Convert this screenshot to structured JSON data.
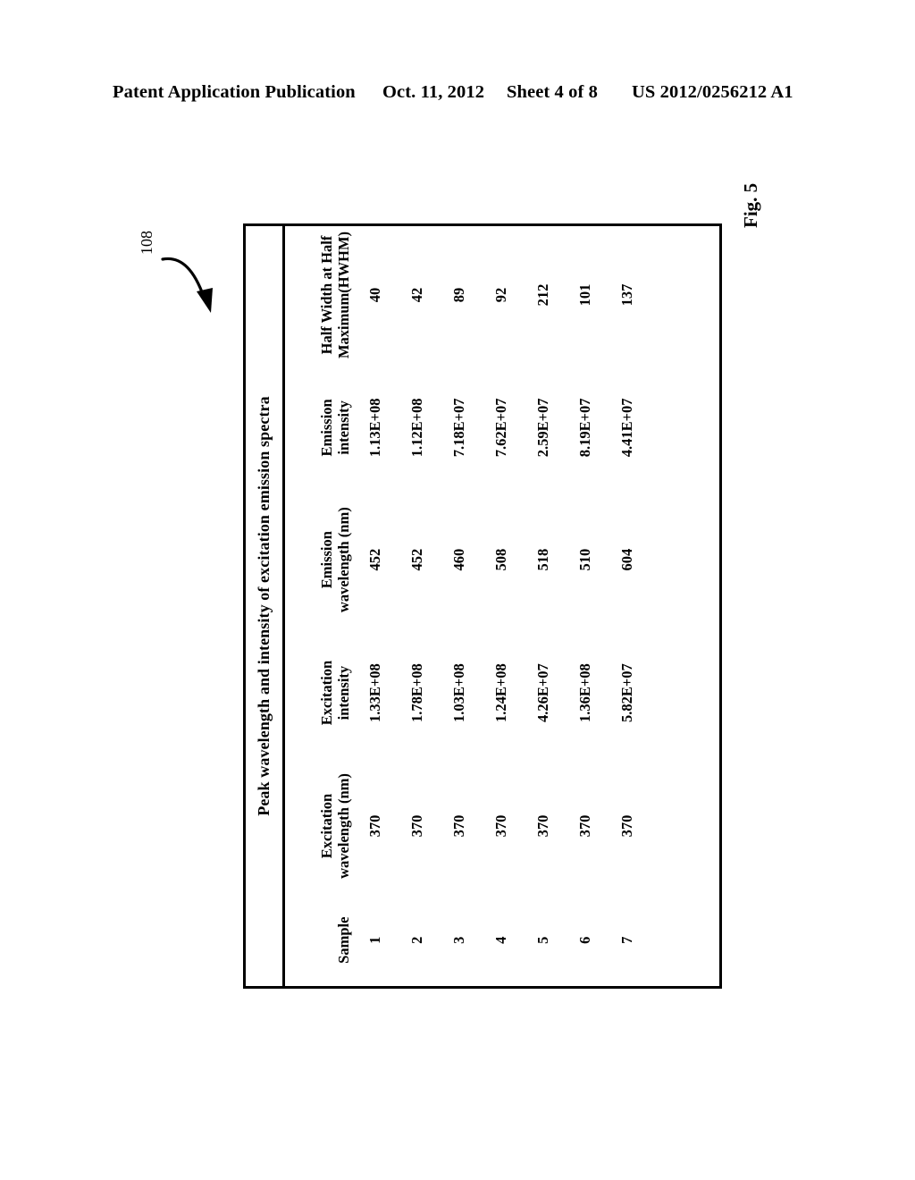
{
  "page_header": {
    "publication": "Patent Application Publication",
    "date": "Oct. 11, 2012",
    "sheet": "Sheet 4 of 8",
    "publication_number": "US 2012/0256212 A1"
  },
  "figure": {
    "label": "Fig. 5",
    "reference_numeral": "108",
    "lead_arrow_icon": "curved-arrow-icon"
  },
  "table": {
    "title": "Peak wavelength and intensity of excitation emission spectra",
    "columns": [
      {
        "line1": "Sample",
        "line2": ""
      },
      {
        "line1": "Excitation",
        "line2": "wavelength (nm)"
      },
      {
        "line1": "Excitation",
        "line2": "intensity"
      },
      {
        "line1": "Emission",
        "line2": "wavelength (nm)"
      },
      {
        "line1": "Emission",
        "line2": "intensity"
      },
      {
        "line1": "Half Width at Half",
        "line2": "Maximum(HWHM)"
      }
    ],
    "rows": [
      {
        "sample": "1",
        "excitation_wavelength": "370",
        "excitation_intensity": "1.33E+08",
        "emission_wavelength": "452",
        "emission_intensity": "1.13E+08",
        "hwhm": "40"
      },
      {
        "sample": "2",
        "excitation_wavelength": "370",
        "excitation_intensity": "1.78E+08",
        "emission_wavelength": "452",
        "emission_intensity": "1.12E+08",
        "hwhm": "42"
      },
      {
        "sample": "3",
        "excitation_wavelength": "370",
        "excitation_intensity": "1.03E+08",
        "emission_wavelength": "460",
        "emission_intensity": "7.18E+07",
        "hwhm": "89"
      },
      {
        "sample": "4",
        "excitation_wavelength": "370",
        "excitation_intensity": "1.24E+08",
        "emission_wavelength": "508",
        "emission_intensity": "7.62E+07",
        "hwhm": "92"
      },
      {
        "sample": "5",
        "excitation_wavelength": "370",
        "excitation_intensity": "4.26E+07",
        "emission_wavelength": "518",
        "emission_intensity": "2.59E+07",
        "hwhm": "212"
      },
      {
        "sample": "6",
        "excitation_wavelength": "370",
        "excitation_intensity": "1.36E+08",
        "emission_wavelength": "510",
        "emission_intensity": "8.19E+07",
        "hwhm": "101"
      },
      {
        "sample": "7",
        "excitation_wavelength": "370",
        "excitation_intensity": "5.82E+07",
        "emission_wavelength": "604",
        "emission_intensity": "4.41E+07",
        "hwhm": "137"
      }
    ]
  },
  "colors": {
    "ink": "#000000",
    "paper": "#ffffff"
  }
}
